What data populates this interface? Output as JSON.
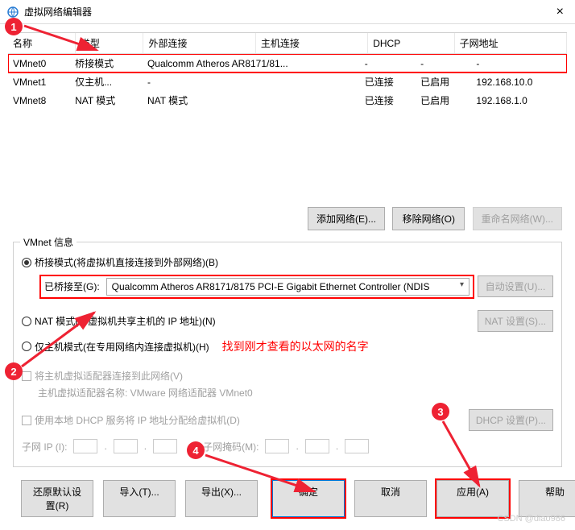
{
  "window": {
    "title": "虚拟网络编辑器",
    "close_glyph": "×"
  },
  "table": {
    "headers": [
      "名称",
      "类型",
      "外部连接",
      "主机连接",
      "DHCP",
      "子网地址"
    ],
    "rows": [
      {
        "name": "VMnet0",
        "type": "桥接模式",
        "ext": "Qualcomm Atheros AR8171/81...",
        "host": "-",
        "dhcp": "-",
        "subnet": "-",
        "hl": true
      },
      {
        "name": "VMnet1",
        "type": "仅主机...",
        "ext": "-",
        "host": "已连接",
        "dhcp": "已启用",
        "subnet": "192.168.10.0"
      },
      {
        "name": "VMnet8",
        "type": "NAT 模式",
        "ext": "NAT 模式",
        "host": "已连接",
        "dhcp": "已启用",
        "subnet": "192.168.1.0"
      }
    ]
  },
  "buttons": {
    "add_net": "添加网络(E)...",
    "remove_net": "移除网络(O)",
    "rename_net": "重命名网络(W)...",
    "auto": "自动设置(U)...",
    "nat": "NAT 设置(S)...",
    "dhcp": "DHCP 设置(P)...",
    "restore": "还原默认设置(R)",
    "import": "导入(T)...",
    "export": "导出(X)...",
    "ok": "确定",
    "cancel": "取消",
    "apply": "应用(A)",
    "help": "帮助"
  },
  "group": {
    "title": "VMnet 信息",
    "radio_bridge": "桥接模式(将虚拟机直接连接到外部网络)(B)",
    "bridged_to": "已桥接至(G):",
    "adapter": "Qualcomm Atheros AR8171/8175 PCI-E Gigabit Ethernet Controller (NDIS",
    "radio_nat": "NAT 模式(与虚拟机共享主机的 IP 地址)(N)",
    "radio_host": "仅主机模式(在专用网络内连接虚拟机)(H)",
    "chk_connect": "将主机虚拟适配器连接到此网络(V)",
    "adapter_name": "主机虚拟适配器名称: VMware 网络适配器 VMnet0",
    "chk_dhcp": "使用本地 DHCP 服务将 IP 地址分配给虚拟机(D)",
    "subnet_ip": "子网 IP (I):",
    "subnet_mask": "子网掩码(M):"
  },
  "annotations": {
    "red_text": "找到刚才查看的以太网的名字",
    "c1": "1",
    "c2": "2",
    "c3": "3",
    "c4": "4"
  },
  "watermark": "CSDN @diao986"
}
